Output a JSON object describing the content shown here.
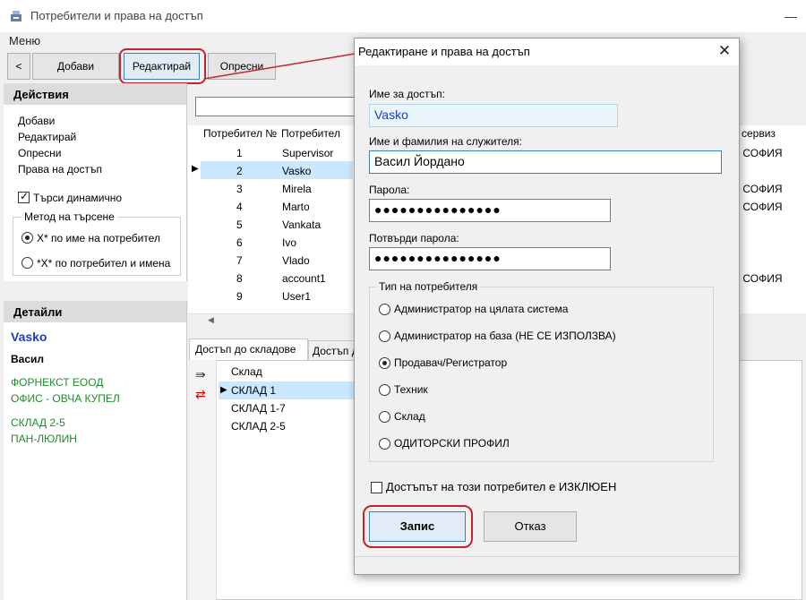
{
  "window": {
    "title": "Потребители и права на достъп",
    "minimize": "—"
  },
  "menu": {
    "label": "Меню"
  },
  "toolbar": {
    "back": "<",
    "add": "Добави",
    "edit": "Редактирай",
    "refresh": "Опресни"
  },
  "actions": {
    "title": "Действия",
    "items": [
      "Добави",
      "Редактирай",
      "Опресни",
      "Права на достъп"
    ],
    "dynamic_search": "Търси динамично",
    "search_method": {
      "legend": "Метод на търсене",
      "options": [
        "X* по име на потребител",
        "*X* по потребител и имена"
      ],
      "selected": 0
    }
  },
  "details": {
    "title": "Детайли",
    "login": "Vasko",
    "name": "Васил",
    "lines": [
      "ФОРНЕКСТ ЕООД",
      "ОФИС - ОВЧА КУПЕЛ",
      "СКЛАД 2-5",
      "ПАН-ЛЮЛИН"
    ]
  },
  "grid": {
    "columns": [
      "Потребител №",
      "Потребител",
      "а сервиз"
    ],
    "rows": [
      {
        "num": "1",
        "user": "Supervisor",
        "service": "А СОФИЯ"
      },
      {
        "num": "2",
        "user": "Vasko",
        "service": ""
      },
      {
        "num": "3",
        "user": "Mirela",
        "service": "А СОФИЯ"
      },
      {
        "num": "4",
        "user": "Marto",
        "service": "А СОФИЯ"
      },
      {
        "num": "5",
        "user": "Vankata",
        "service": ""
      },
      {
        "num": "6",
        "user": "Ivo",
        "service": ""
      },
      {
        "num": "7",
        "user": "Vlado",
        "service": ""
      },
      {
        "num": "8",
        "user": "account1",
        "service": "А СОФИЯ"
      },
      {
        "num": "9",
        "user": "User1",
        "service": ""
      }
    ],
    "selected_row": 1
  },
  "tabs": [
    "Достъп до складове",
    "Достъп д"
  ],
  "warehouses": {
    "column": "Склад",
    "rows": [
      "СКЛАД 1",
      "СКЛАД 1-7",
      "СКЛАД 2-5"
    ],
    "selected": 0
  },
  "dialog": {
    "title": "Редактиране и права на достъп",
    "close": "✕",
    "login_label": "Име за достъп:",
    "login_value": "Vasko",
    "name_label": "Име и фамилия на служителя:",
    "name_value": "Васил Йордано",
    "password_label": "Парола:",
    "password_value": "●●●●●●●●●●●●●●●",
    "confirm_label": "Потвърди парола:",
    "confirm_value": "●●●●●●●●●●●●●●●",
    "user_type": {
      "legend": "Тип на потребителя",
      "options": [
        "Администратор на цялата система",
        "Администратор на база (НЕ СЕ ИЗПОЛЗВА)",
        "Продавач/Регистратор",
        "Техник",
        "Склад",
        "ОДИТОРСКИ ПРОФИЛ"
      ],
      "selected": 2
    },
    "disabled_label": "Достъпът на този потребител е ИЗКЛЮЕН",
    "save": "Запис",
    "cancel": "Отказ"
  },
  "colors": {
    "accent": "#1f3cbf",
    "highlight": "#c4242e",
    "details_green": "#1e8a2a",
    "selection": "#cce8ff"
  }
}
